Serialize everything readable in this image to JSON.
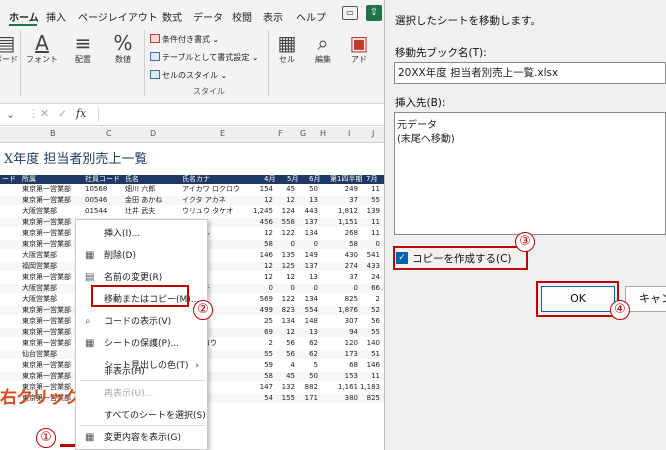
{
  "ribbon": {
    "tabs": [
      "ホーム",
      "挿入",
      "ページレイアウト",
      "数式",
      "データ",
      "校閲",
      "表示",
      "ヘルプ"
    ],
    "buttons": {
      "board": "ボード",
      "font": "フォント",
      "align": "配置",
      "number": "数値",
      "cell": "セル",
      "edit": "編集",
      "ai": "アド"
    },
    "styles": {
      "conditional": "条件付き書式 ⌄",
      "table": "テーブルとして書式設定 ⌄",
      "cell": "セルのスタイル ⌄"
    },
    "group_label": "スタイル",
    "pct": "%"
  },
  "formula_bar": {
    "fx": "fx"
  },
  "sheet": {
    "columns": [
      "B",
      "C",
      "D",
      "E",
      "F",
      "G",
      "H",
      "I",
      "J"
    ],
    "title": "X年度 担当者別売上一覧",
    "header": [
      "ード",
      "所属",
      "社員コード",
      "氏名",
      "氏名カナ",
      "4月",
      "5月",
      "6月",
      "第1四半期",
      "7月"
    ],
    "rows": [
      [
        "東京第一営業部",
        "10568",
        "畑川 六郎",
        "アイカワ ロクロウ",
        "154",
        "45",
        "50",
        "249",
        "11"
      ],
      [
        "東京第一営業部",
        "00546",
        "金田 あかね",
        "イクタ アカネ",
        "12",
        "12",
        "13",
        "37",
        "55"
      ],
      [
        "大阪営業部",
        "01544",
        "辻井 武夫",
        "ウリュウ タケオ",
        "1,245",
        "124",
        "443",
        "1,812",
        "139"
      ],
      [
        "東京第一営業部",
        "",
        "",
        "",
        "456",
        "558",
        "137",
        "1,151",
        "11"
      ],
      [
        "東京第一営業部",
        "",
        "",
        "スツハル",
        "12",
        "122",
        "134",
        "268",
        "11"
      ],
      [
        "東京第一営業部",
        "",
        "",
        "ンゲキ",
        "58",
        "0",
        "0",
        "58",
        "0"
      ],
      [
        "大阪営業部",
        "",
        "",
        "ミウリ",
        "146",
        "135",
        "149",
        "430",
        "541"
      ],
      [
        "福岡営業部",
        "",
        "",
        "ネイ",
        "12",
        "125",
        "137",
        "274",
        "433"
      ],
      [
        "東京第一営業部",
        "",
        "",
        "サナエ",
        "12",
        "12",
        "13",
        "37",
        "24"
      ],
      [
        "大阪営業部",
        "",
        "",
        "ヨリイチ",
        "0",
        "0",
        "0",
        "0",
        "66"
      ],
      [
        "大阪営業部",
        "",
        "",
        "",
        "569",
        "122",
        "134",
        "825",
        "2"
      ],
      [
        "東京第一営業部",
        "",
        "",
        "ン",
        "499",
        "823",
        "554",
        "1,876",
        "52"
      ],
      [
        "東京第一営業部",
        "",
        "",
        "カズト",
        "25",
        "134",
        "148",
        "307",
        "56"
      ],
      [
        "東京第一営業部",
        "",
        "",
        "ジョン",
        "69",
        "12",
        "13",
        "94",
        "55"
      ],
      [
        "東京第一営業部",
        "",
        "",
        "レンジロウ",
        "2",
        "56",
        "62",
        "120",
        "140"
      ],
      [
        "仙台営業部",
        "",
        "",
        "スバル",
        "55",
        "56",
        "62",
        "173",
        "51"
      ],
      [
        "東京第一営業部",
        "",
        "",
        "クコ",
        "59",
        "4",
        "5",
        "68",
        "146"
      ],
      [
        "東京第一営業部",
        "",
        "",
        "オ",
        "58",
        "45",
        "50",
        "153",
        "11"
      ],
      [
        "東京第一営業部",
        "",
        "",
        "ショウ",
        "147",
        "132",
        "882",
        "1,161",
        "1,183"
      ],
      [
        "東京第一営業部",
        "",
        "",
        "エデ",
        "54",
        "155",
        "171",
        "380",
        "825"
      ]
    ]
  },
  "context_menu": {
    "items": [
      {
        "icon": "",
        "label": "挿入(I)..."
      },
      {
        "icon": "▦",
        "label": "削除(D)"
      },
      {
        "icon": "▤",
        "label": "名前の変更(R)"
      },
      {
        "icon": "",
        "label": "移動またはコピー(M)..."
      },
      {
        "icon": "⌕",
        "label": "コードの表示(V)"
      },
      {
        "icon": "▦",
        "label": "シートの保護(P)..."
      },
      {
        "icon": "",
        "label": "シート見出しの色(T)",
        "arrow": "›"
      },
      {
        "icon": "",
        "label": "非表示(H)"
      },
      {
        "icon": "",
        "label": "再表示(U)..."
      },
      {
        "icon": "",
        "label": "すべてのシートを選択(S)"
      },
      {
        "icon": "▦",
        "label": "変更内容を表示(G)"
      }
    ]
  },
  "annotations": {
    "right_click": "右クリック",
    "n1": "①",
    "n2": "②",
    "n3": "③",
    "n4": "④"
  },
  "dialog": {
    "heading": "選択したシートを移動します。",
    "book_label": "移動先ブック名(T):",
    "book_value": "20XX年度 担当者別売上一覧.xlsx",
    "insert_label": "挿入先(B):",
    "sheets": [
      "元データ",
      "(末尾へ移動)"
    ],
    "copy_label": "コピーを作成する(C)",
    "copy_checked": true,
    "ok": "OK",
    "cancel": "キャンセル"
  },
  "window": {
    "close_glyph": "▭"
  }
}
